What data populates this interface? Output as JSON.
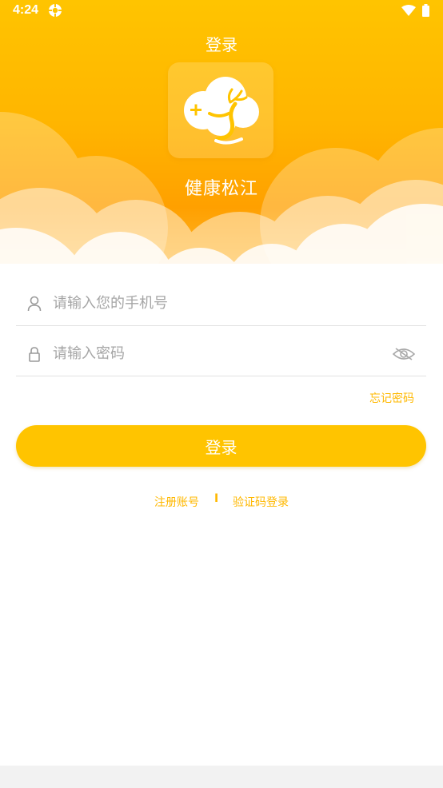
{
  "status_bar": {
    "time": "4:24",
    "icons": [
      "app-notification-icon",
      "wifi-icon",
      "battery-icon"
    ]
  },
  "header": {
    "title": "登录",
    "app_name": "健康松江",
    "logo_icon": "deer-cloud-plus-icon"
  },
  "form": {
    "phone": {
      "placeholder": "请输入您的手机号",
      "value": "",
      "icon": "user-icon"
    },
    "password": {
      "placeholder": "请输入密码",
      "value": "",
      "icon": "lock-icon",
      "toggle_icon": "eye-hidden-icon"
    },
    "forgot_password": "忘记密码",
    "submit_label": "登录"
  },
  "links": {
    "register": "注册账号",
    "divider": "I",
    "sms_login": "验证码登录"
  },
  "colors": {
    "accent": "#FFC400",
    "link": "#FFB800",
    "header_top": "#FFC400",
    "header_bottom": "#FFA000"
  }
}
